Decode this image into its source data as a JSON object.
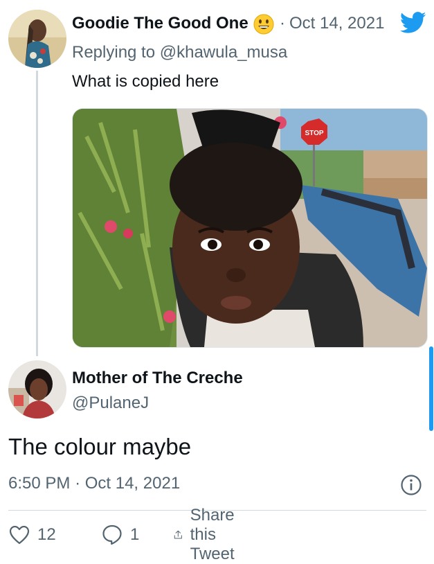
{
  "parent_tweet": {
    "author_name": "Goodie The Good One",
    "emoji": "😃",
    "separator": "·",
    "date": "Oct 14, 2021",
    "replying_prefix": "Replying to ",
    "replying_handle": "@khawula_musa",
    "text": "What is copied here",
    "icons": {
      "logo": "twitter-bird-icon",
      "emoji": "grinning-face-icon"
    }
  },
  "reply_tweet": {
    "author_name": "Mother of The Creche",
    "handle": "@PulaneJ",
    "text": "The colour maybe",
    "time": "6:50 PM",
    "separator": "·",
    "date": "Oct 14, 2021"
  },
  "actions": {
    "like_count": "12",
    "reply_count": "1",
    "share_label": "Share this Tweet"
  },
  "photo": {
    "sign_text": "STOP"
  },
  "colors": {
    "accent": "#1d9bf0",
    "secondary_text": "#536471",
    "divider": "#cfd9de"
  }
}
